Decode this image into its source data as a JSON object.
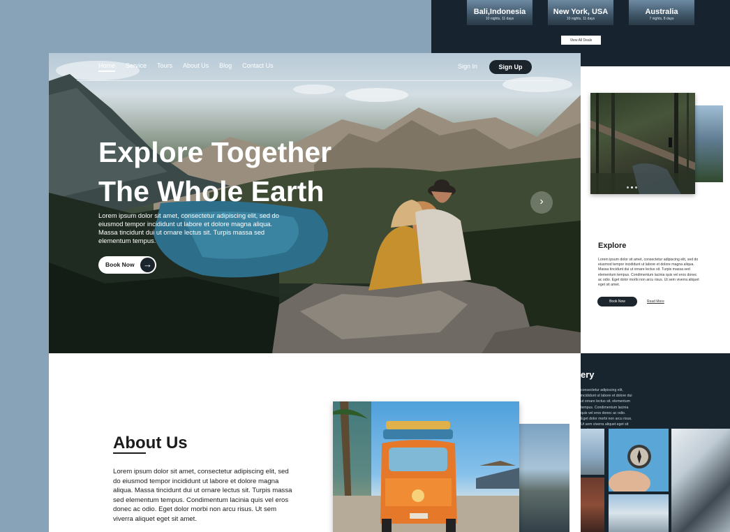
{
  "deals": {
    "cards": [
      {
        "name": "Bali,Indonesia",
        "sub": "10 nights, 11 days"
      },
      {
        "name": "New York, USA",
        "sub": "10 nights, 11 days"
      },
      {
        "name": "Australia",
        "sub": "7 nights, 8 days"
      }
    ],
    "view_all_label": "View All Deals"
  },
  "nav": {
    "items": [
      "Home",
      "Service",
      "Tours",
      "About Us",
      "Blog",
      "Contact Us"
    ],
    "active": "Home",
    "signin_label": "Sign In",
    "signup_label": "Sign Up"
  },
  "hero": {
    "title_line1": "Explore Together",
    "title_line2": "The Whole Earth",
    "description": "Lorem ipsum dolor sit amet, consectetur adipiscing elit, sed do eiusmod tempor incididunt ut labore et dolore magna aliqua. Massa tincidunt dui ut ornare lectus sit. Turpis massa sed elementum tempus.",
    "book_label": "Book Now",
    "arrow_icon": "arrow-right-icon",
    "next_icon": "chevron-right-icon"
  },
  "explore": {
    "title": "Explore",
    "text": "Lorem ipsum dolor sit amet, consectetur adipiscing elit, sed do eiusmod tempor incididunt ut labore et dolore magna aliqua. Massa tincidunt dui ut ornare lectus sit. Turpis massa sed elementum tempus. Condimentum lacinia quis vel eros donec ac odio. Eget dolor morbi non arcu risus. Ut sem viverra aliquet eget sit amet.",
    "book_label": "Book Now",
    "read_more_label": "Read More"
  },
  "gallery": {
    "title": "ery",
    "text": "consectetur adipiscing elit, incididunt ut labore et dolore dui ut ornare lectus sit. elementum tempus. Condimentum lacinia quis vel eros donec ac odio. Eget dolor morbi non arcu risus. Ut sem viverra aliquet eget sit amet."
  },
  "about": {
    "title": "About Us",
    "text": "Lorem ipsum dolor sit amet, consectetur adipiscing elit, sed do eiusmod tempor incididunt ut labore et dolore magna aliqua. Massa tincidunt dui ut ornare lectus sit. Turpis massa sed elementum tempus. Condimentum lacinia quis vel eros donec ac odio. Eget dolor morbi non arcu risus. Ut sem viverra aliquet eget sit amet."
  },
  "colors": {
    "background": "#88a3b7",
    "dark_panel": "#17232e",
    "button_dark": "#1b232b",
    "text_dark": "#1b1b1b"
  }
}
